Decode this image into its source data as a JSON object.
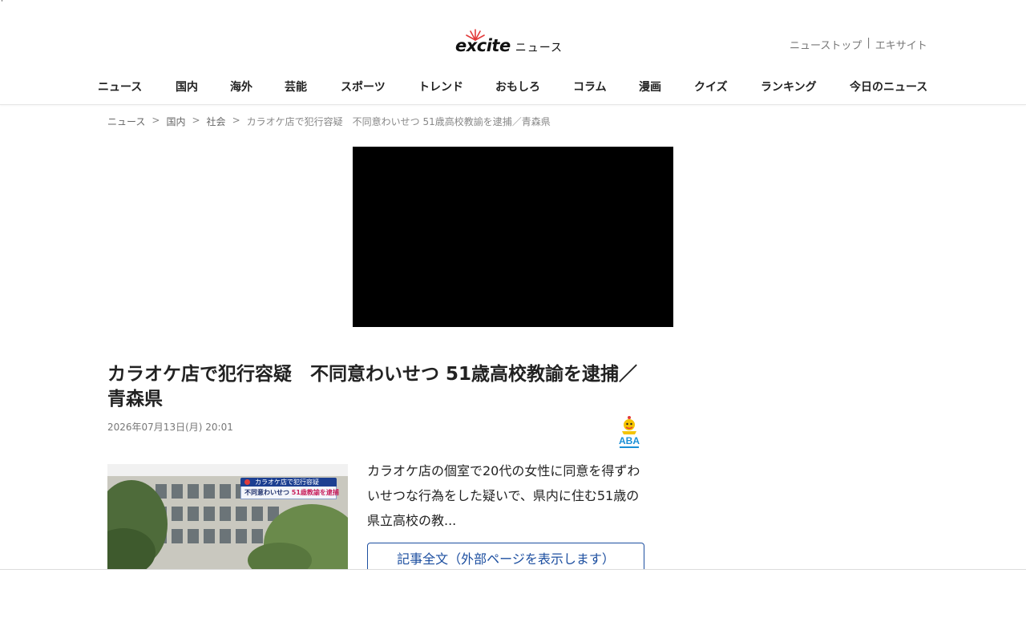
{
  "stray_mark": "'",
  "header": {
    "logo_text": "excite",
    "logo_sub": "ニュース",
    "toplinks": [
      "ニューストップ",
      "|",
      "エキサイト"
    ]
  },
  "nav": [
    "ニュース",
    "国内",
    "海外",
    "芸能",
    "スポーツ",
    "トレンド",
    "おもしろ",
    "コラム",
    "漫画",
    "クイズ",
    "ランキング",
    "今日のニュース"
  ],
  "breadcrumb": {
    "items": [
      "ニュース",
      "国内",
      "社会"
    ],
    "current": "カラオケ店で犯行容疑　不同意わいせつ 51歳高校教諭を逮捕／青森県",
    "separator": ">"
  },
  "article": {
    "title": "カラオケ店で犯行容疑　不同意わいせつ 51歳高校教諭を逮捕／青森県",
    "date": "2026年07月13日(月) 20:01",
    "source_logo": "ABA",
    "thumbnail": {
      "caption_top": "カラオケ店で犯行容疑",
      "caption_bottom_prefix": "不同意わいせつ",
      "caption_bottom_highlight": "51歳教諭を逮捕"
    },
    "summary": "カラオケ店の個室で20代の女性に同意を得ずわいせつな行為をした疑いで、県内に住む51歳の県立高校の教...",
    "fulltext_button": "記事全文（外部ページを表示します）"
  },
  "colors": {
    "link_blue": "#1d4fa0",
    "video_bg": "#000000",
    "caption_navy": "#1c3f91",
    "caption_pink": "#c81e5a"
  }
}
